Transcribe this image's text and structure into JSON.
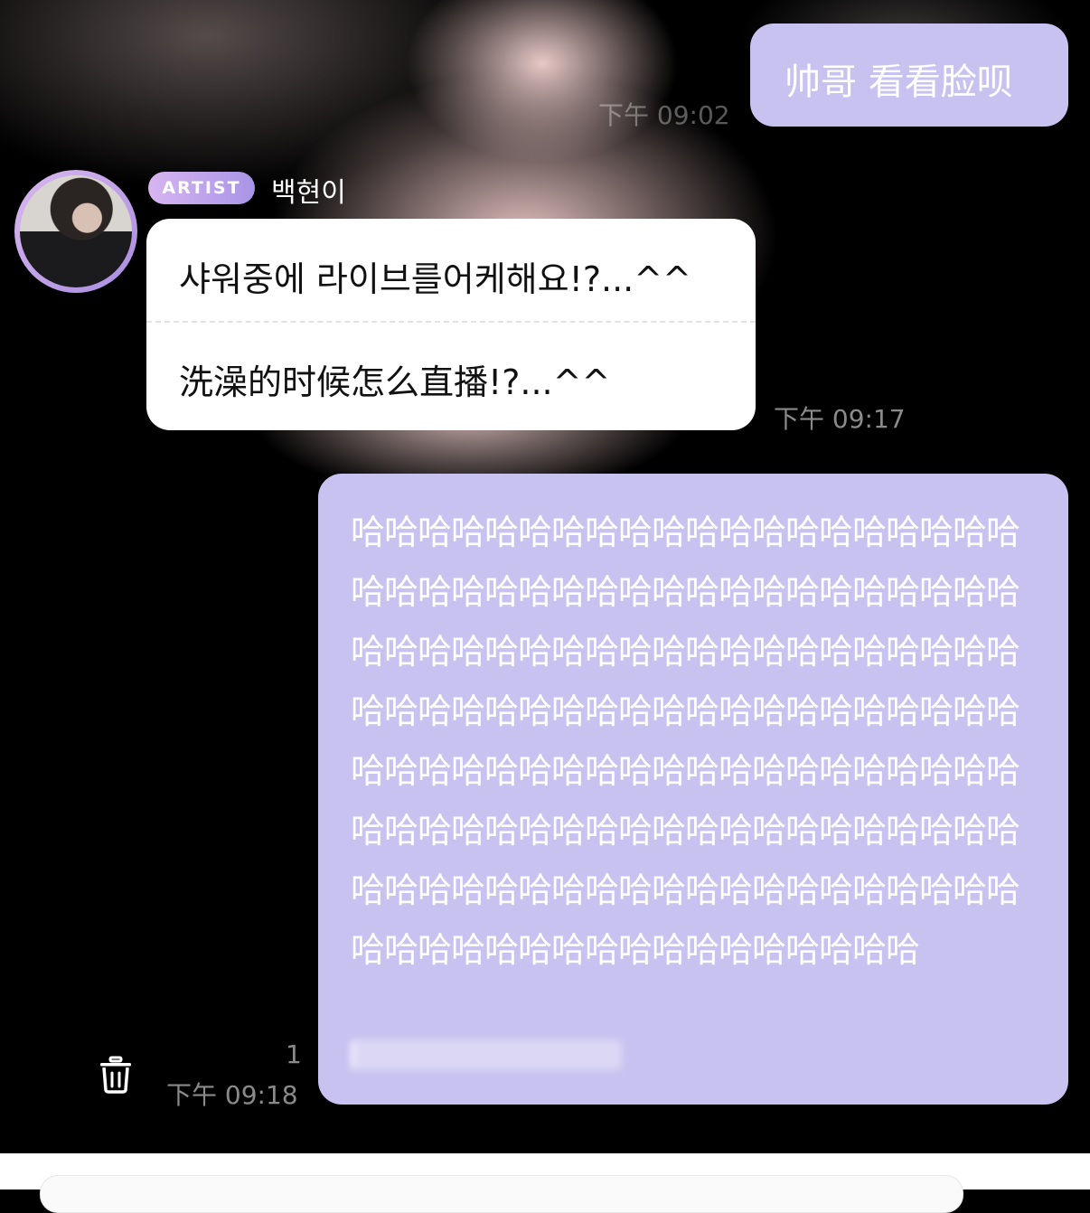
{
  "messages": {
    "out_1": {
      "text": "帅哥 看看脸呗",
      "time": "下午 09:02"
    },
    "in_1": {
      "badge": "ARTIST",
      "sender": "백현이",
      "original": "샤워중에 라이브를어케해요!?...^^",
      "translation": "洗澡的时候怎么直播!?...^^",
      "time": "下午 09:17"
    },
    "out_2": {
      "text": "哈哈哈哈哈哈哈哈哈哈哈哈哈哈哈哈哈哈哈哈哈哈哈哈哈哈哈哈哈哈哈哈哈哈哈哈哈哈哈哈哈哈哈哈哈哈哈哈哈哈哈哈哈哈哈哈哈哈哈哈哈哈哈哈哈哈哈哈哈哈哈哈哈哈哈哈哈哈哈哈哈哈哈哈哈哈哈哈哈哈哈哈哈哈哈哈哈哈哈哈哈哈哈哈哈哈哈哈哈哈哈哈哈哈哈哈哈哈哈哈哈哈哈哈哈哈哈哈哈哈哈哈哈哈哈哈哈哈哈哈哈哈哈哈哈哈哈哈哈哈哈哈哈哈哈哈哈",
      "unread": "1",
      "time": "下午 09:18"
    }
  },
  "icons": {
    "delete": "trash-icon"
  },
  "colors": {
    "out_bubble": "#c8c2f0",
    "in_bubble": "#ffffff",
    "badge_from": "#d7b5f0",
    "badge_to": "#a894e6"
  }
}
